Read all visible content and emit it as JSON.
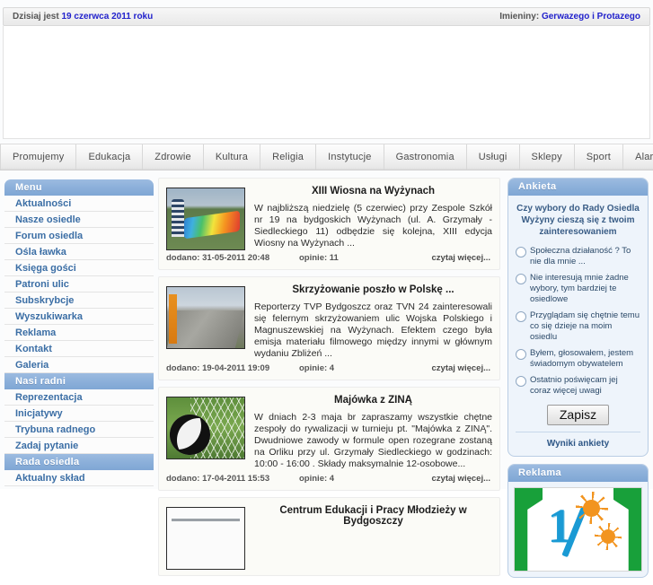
{
  "topbar": {
    "today_label": "Dzisiaj jest",
    "today_date": "19 czerwca 2011 roku",
    "nameday_label": "Imieniny:",
    "nameday_value": "Gerwazego i Protazego"
  },
  "navbar": {
    "items": [
      {
        "label": "Promujemy"
      },
      {
        "label": "Edukacja"
      },
      {
        "label": "Zdrowie"
      },
      {
        "label": "Kultura"
      },
      {
        "label": "Religia"
      },
      {
        "label": "Instytucje"
      },
      {
        "label": "Gastronomia"
      },
      {
        "label": "Usługi"
      },
      {
        "label": "Sklepy"
      },
      {
        "label": "Sport"
      },
      {
        "label": "Alarmowe"
      }
    ]
  },
  "sidebar_left": {
    "groups": [
      {
        "title": "Menu",
        "items": [
          {
            "label": "Aktualności"
          },
          {
            "label": "Nasze osiedle"
          },
          {
            "label": "Forum osiedla"
          },
          {
            "label": "Ośla ławka"
          },
          {
            "label": "Księga gości"
          },
          {
            "label": "Patroni ulic"
          },
          {
            "label": "Subskrybcje"
          },
          {
            "label": "Wyszukiwarka"
          },
          {
            "label": "Reklama"
          },
          {
            "label": "Kontakt"
          },
          {
            "label": "Galeria"
          }
        ]
      },
      {
        "title": "Nasi radni",
        "items": [
          {
            "label": "Reprezentacja"
          },
          {
            "label": "Inicjatywy"
          },
          {
            "label": "Trybuna radnego"
          },
          {
            "label": "Zadaj pytanie"
          }
        ]
      },
      {
        "title": "Rada osiedla",
        "items": [
          {
            "label": "Aktualny skład"
          }
        ]
      }
    ]
  },
  "articles": [
    {
      "title": "XIII Wiosna na Wyżynach",
      "body": "W najbliższą niedzielę (5 czerwiec) przy Zespole Szkół nr 19 na bydgoskich Wyżynach (ul. A. Grzymały - Siedleckiego 11) odbędzie się kolejna, XIII edycja Wiosny na Wyżynach ...",
      "added_label": "dodano: 31-05-2011 20:48",
      "comments_label": "opinie: 11",
      "more_label": "czytaj więcej...",
      "thumb": "children-parachute-photo"
    },
    {
      "title": "Skrzyżowanie poszło w Polskę ...",
      "body": "Reporterzy TVP Bydgoszcz oraz TVN 24 zainteresowali się felernym skrzyżowaniem ulic Wojska Polskiego i Magnuszewskiej na Wyżynach. Efektem czego była emisja materiału filmowego między innymi w głównym wydaniu Zbliżeń ...",
      "added_label": "dodano: 19-04-2011 19:09",
      "comments_label": "opinie: 4",
      "more_label": "czytaj więcej...",
      "thumb": "street-crossing-photo"
    },
    {
      "title": "Majówka z ZINĄ",
      "body": "W dniach 2-3 maja br zapraszamy wszystkie chętne zespoły do rywalizacji w turnieju pt. \"Majówka z ZINĄ\". Dwudniowe zawody w formule open rozegrane zostaną na Orliku przy ul. Grzymały Siedleckiego w godzinach: 10:00 - 16:00 . Składy maksymalnie 12-osobowe...",
      "added_label": "dodano: 17-04-2011 15:53",
      "comments_label": "opinie: 4",
      "more_label": "czytaj więcej...",
      "thumb": "football-goal-photo"
    },
    {
      "title": "Centrum Edukacji i Pracy Młodzieży w Bydgoszczy",
      "body": "",
      "added_label": "",
      "comments_label": "",
      "more_label": "",
      "thumb": "document-photo"
    }
  ],
  "poll": {
    "title": "Ankieta",
    "question": "Czy wybory do Rady Osiedla Wyżyny cieszą się z twoim zainteresowaniem",
    "options": [
      {
        "label": "Społeczna działaność ? To nie dla mnie ..."
      },
      {
        "label": "Nie interesują mnie żadne wybory, tym bardziej te osiedlowe"
      },
      {
        "label": "Przyglądam się chętnie temu co się dzieje na moim osiedlu"
      },
      {
        "label": "Byłem, głosowałem, jestem świadomym obywatelem"
      },
      {
        "label": "Ostatnio poświęcam jej coraz więcej uwagi"
      }
    ],
    "submit_label": "Zapisz",
    "results_label": "Wyniki ankiety"
  },
  "ad": {
    "title": "Reklama",
    "banner_alt": "one-percent-tax-banner"
  },
  "colors": {
    "accent_blue": "#8cb0da",
    "link_blue": "#3b6ea5",
    "highlight_blue": "#2222cc",
    "ad_green": "#18a03a",
    "ad_cyan": "#1a9ad4",
    "ad_orange": "#f2941f"
  }
}
